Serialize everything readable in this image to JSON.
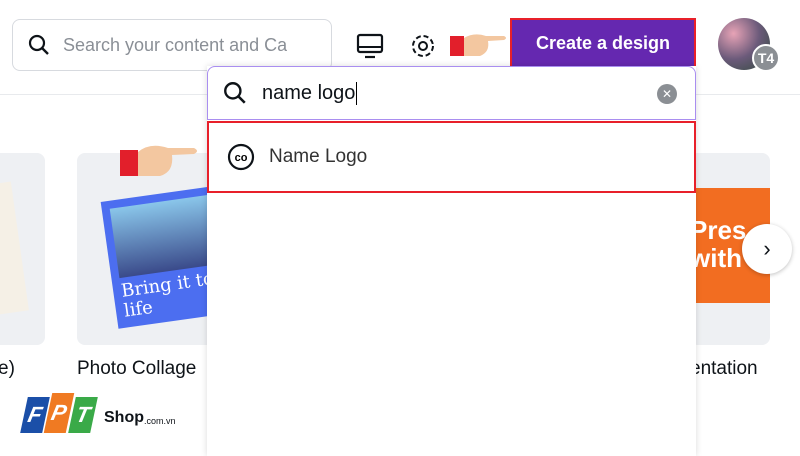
{
  "search": {
    "placeholder": "Search your content and Ca"
  },
  "header": {
    "create_label": "Create a design",
    "avatar_badge": "T4"
  },
  "dropdown": {
    "query": "name logo",
    "result_label": "Name Logo"
  },
  "cards": [
    {
      "caption": "e)"
    },
    {
      "caption": "Photo Collage",
      "preview_text": "Bring it to life"
    },
    {
      "caption": "entation",
      "preview_text": "Pres with"
    }
  ],
  "watermark": {
    "letters": [
      "F",
      "P",
      "T"
    ],
    "text": "Shop",
    "suffix": ".com.vn"
  },
  "colors": {
    "brand": "#6528b0",
    "highlight": "#e8202a"
  }
}
